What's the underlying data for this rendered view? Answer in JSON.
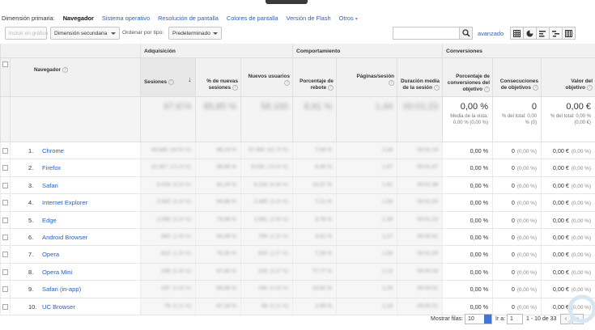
{
  "dimension_bar": {
    "label": "Dimensión primaria:",
    "active": "Navegador",
    "links": [
      "Sistema operativo",
      "Resolución de pantalla",
      "Colores de pantalla",
      "Versión de Flash"
    ],
    "more": "Otros"
  },
  "toolbar": {
    "plot_button": "Incluir en gráfico",
    "secondary_dim": "Dimensión secundaria",
    "sort_label": "Ordenar por tipo:",
    "sort_value": "Predeterminado",
    "search_placeholder": "",
    "advanced_link": "avanzado"
  },
  "groups": {
    "acquisition": "Adquisición",
    "behavior": "Comportamiento",
    "conversions": "Conversiones"
  },
  "columns": {
    "browser": "Navegador",
    "sessions": "Sesiones",
    "new_sessions_pct": "% de nuevas sesiones",
    "new_users": "Nuevos usuarios",
    "bounce_rate": "Porcentaje de rebote",
    "pages_per_session": "Páginas/sesión",
    "avg_duration": "Duración media de la sesión",
    "conv_rate": "Porcentaje de conversiones del objetivo",
    "goal_completions": "Consecuciones de objetivos",
    "goal_value": "Valor del objetivo"
  },
  "totals": {
    "sessions": "67.674",
    "new_sessions_pct": "85,85 %",
    "new_users": "58.100",
    "bounce_rate": "8,91 %",
    "pages_per_session": "1,44",
    "avg_duration": "00:01:23",
    "conv_rate": "0,00 %",
    "conv_rate_sub": "Media de la vista: 0,00 % (0,00 %)",
    "goal_completions": "0",
    "goal_completions_sub": "% del total: 0,00 % (0)",
    "goal_value": "0,00 €",
    "goal_value_sub": "% del total: 0,00 % (0,00 €)"
  },
  "rows": [
    {
      "idx": "1.",
      "name": "Chrome",
      "sessions": "43.649",
      "sp": "(64,50 %)",
      "nsp": "86,19 %",
      "nu": "37.060",
      "nup": "(63,79 %)",
      "br": "7,54 %",
      "pps": "1,34",
      "dur": "00:01:14",
      "cr": "0,00 %",
      "gc": "0",
      "gcp": "(0,00 %)",
      "gv": "0,00 €",
      "gvp": "(0,00 %)"
    },
    {
      "idx": "2.",
      "name": "Firefox",
      "sessions": "10.307",
      "sp": "(15,23 %)",
      "nsp": "89,95 %",
      "nu": "9.030",
      "nup": "(15,54 %)",
      "br": "6,40 %",
      "pps": "1,87",
      "dur": "00:01:47",
      "cr": "0,00 %",
      "gc": "0",
      "gcp": "(0,00 %)",
      "gv": "0,00 €",
      "gvp": "(0,00 %)"
    },
    {
      "idx": "3.",
      "name": "Safari",
      "sessions": "6.429",
      "sp": "(9,50 %)",
      "nsp": "81,25 %",
      "nu": "5.216",
      "nup": "(8,98 %)",
      "br": "15,37 %",
      "pps": "1,51",
      "dur": "00:01:38",
      "cr": "0,00 %",
      "gc": "0",
      "gcp": "(0,00 %)",
      "gv": "0,00 €",
      "gvp": "(0,00 %)"
    },
    {
      "idx": "4.",
      "name": "Internet Explorer",
      "sessions": "2.940",
      "sp": "(4,34 %)",
      "nsp": "84,86 %",
      "nu": "2.495",
      "nup": "(4,29 %)",
      "br": "7,21 %",
      "pps": "1,55",
      "dur": "00:01:25",
      "cr": "0,00 %",
      "gc": "0",
      "gcp": "(0,00 %)",
      "gv": "0,00 €",
      "gvp": "(0,00 %)"
    },
    {
      "idx": "5.",
      "name": "Edge",
      "sessions": "2.098",
      "sp": "(3,10 %)",
      "nsp": "79,96 %",
      "nu": "1.661",
      "nup": "(2,86 %)",
      "br": "9,78 %",
      "pps": "1,39",
      "dur": "00:01:23",
      "cr": "0,00 %",
      "gc": "0",
      "gcp": "(0,00 %)",
      "gv": "0,00 €",
      "gvp": "(0,00 %)"
    },
    {
      "idx": "6.",
      "name": "Android Browser",
      "sessions": "943",
      "sp": "(1,39 %)",
      "nsp": "80,49 %",
      "nu": "759",
      "nup": "(1,31 %)",
      "br": "5,51 %",
      "pps": "1,27",
      "dur": "00:00:41",
      "cr": "0,00 %",
      "gc": "0",
      "gcp": "(0,00 %)",
      "gv": "0,00 €",
      "gvp": "(0,00 %)"
    },
    {
      "idx": "7.",
      "name": "Opera",
      "sessions": "813",
      "sp": "(1,20 %)",
      "nsp": "76,26 %",
      "nu": "620",
      "nup": "(1,07 %)",
      "br": "7,26 %",
      "pps": "1,55",
      "dur": "00:01:29",
      "cr": "0,00 %",
      "gc": "0",
      "gcp": "(0,00 %)",
      "gv": "0,00 €",
      "gvp": "(0,00 %)"
    },
    {
      "idx": "8.",
      "name": "Opera Mini",
      "sessions": "246",
      "sp": "(0,36 %)",
      "nsp": "87,80 %",
      "nu": "216",
      "nup": "(0,37 %)",
      "br": "77,77 %",
      "pps": "1,13",
      "dur": "00:00:24",
      "cr": "0,00 %",
      "gc": "0",
      "gcp": "(0,00 %)",
      "gv": "0,00 €",
      "gvp": "(0,00 %)"
    },
    {
      "idx": "9.",
      "name": "Safari (in-app)",
      "sessions": "187",
      "sp": "(0,28 %)",
      "nsp": "85,56 %",
      "nu": "160",
      "nup": "(0,28 %)",
      "br": "16,82 %",
      "pps": "1,25",
      "dur": "00:00:31",
      "cr": "0,00 %",
      "gc": "0",
      "gcp": "(0,00 %)",
      "gv": "0,00 €",
      "gvp": "(0,00 %)"
    },
    {
      "idx": "10.",
      "name": "UC Browser",
      "sessions": "78",
      "sp": "(0,12 %)",
      "nsp": "87,18 %",
      "nu": "68",
      "nup": "(0,12 %)",
      "br": "2,56 %",
      "pps": "1,18",
      "dur": "00:00:21",
      "cr": "0,00 %",
      "gc": "0",
      "gcp": "(0,00 %)",
      "gv": "0,00 €",
      "gvp": "(0,00 %)"
    }
  ],
  "footer": {
    "show_rows_label": "Mostrar filas:",
    "show_rows_value": "10",
    "goto_label": "Ir a:",
    "goto_value": "1",
    "range": "1 - 10 de 33",
    "prev": "‹",
    "next": "›"
  }
}
